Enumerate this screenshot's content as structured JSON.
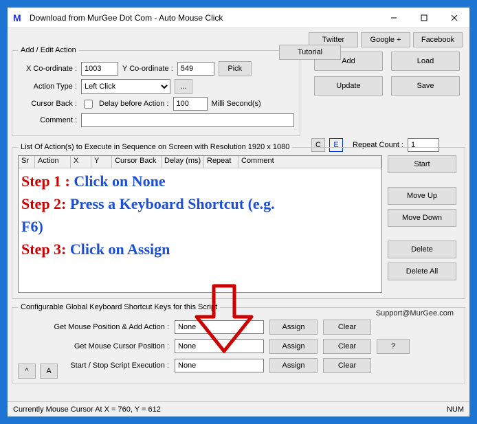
{
  "window": {
    "title": "Download from MurGee Dot Com - Auto Mouse Click"
  },
  "topRight": {
    "twitter": "Twitter",
    "google": "Google +",
    "facebook": "Facebook"
  },
  "editGroup": {
    "legend": "Add / Edit Action",
    "xLabel": "X Co-ordinate :",
    "xValue": "1003",
    "yLabel": "Y Co-ordinate :",
    "yValue": "549",
    "pick": "Pick",
    "actionTypeLabel": "Action Type :",
    "actionTypeValue": "Left Click",
    "ellipsis": "...",
    "cursorBackLabel": "Cursor Back :",
    "delayLabel": "Delay before Action :",
    "delayValue": "100",
    "delayUnits": "Milli Second(s)",
    "commentLabel": "Comment :",
    "commentValue": "",
    "cBtn": "C",
    "eBtn": "E",
    "repeatLabel": "Repeat Count :",
    "repeatValue": "1",
    "tutorial": "Tutorial"
  },
  "crud": {
    "add": "Add",
    "load": "Load",
    "update": "Update",
    "save": "Save"
  },
  "listGroup": {
    "legend": "List Of Action(s) to Execute in Sequence on Screen with Resolution 1920 x 1080",
    "headers": {
      "sr": "Sr",
      "action": "Action",
      "x": "X",
      "y": "Y",
      "cursorBack": "Cursor Back",
      "delay": "Delay (ms)",
      "repeat": "Repeat",
      "comment": "Comment"
    }
  },
  "overlay": {
    "s1a": "Step 1 :",
    "s1b": "Click on None",
    "s2a": "Step 2:",
    "s2b": "Press a Keyboard Shortcut (e.g.",
    "s2c": "F6)",
    "s3a": "Step 3:",
    "s3b": "Click on Assign"
  },
  "sideBtns": {
    "start": "Start",
    "moveUp": "Move Up",
    "moveDown": "Move Down",
    "delete": "Delete",
    "deleteAll": "Delete All"
  },
  "shortcutGroup": {
    "legend": "Configurable Global Keyboard Shortcut Keys for this Script",
    "support": "Support@MurGee.com",
    "rows": {
      "r1": {
        "label": "Get Mouse Position & Add Action :",
        "value": "None"
      },
      "r2": {
        "label": "Get Mouse Cursor Position :",
        "value": "None"
      },
      "r3": {
        "label": "Start / Stop Script Execution :",
        "value": "None"
      }
    },
    "assign": "Assign",
    "clear": "Clear",
    "help": "?"
  },
  "bottomLeft": {
    "caret": "^",
    "a": "A"
  },
  "status": {
    "text": "Currently Mouse Cursor At X = 760, Y = 612",
    "num": "NUM"
  }
}
